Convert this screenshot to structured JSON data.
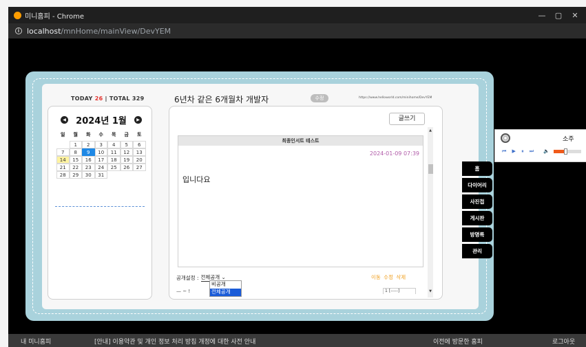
{
  "window": {
    "title": "미니홈피 - Chrome",
    "minimize": "—",
    "maximize": "▢",
    "close": "✕"
  },
  "address": {
    "host": "localhost",
    "path": "/mnHome/mainView/DevYEM"
  },
  "visitors": {
    "today_label": "TODAY",
    "today_count": "26",
    "separator": "|",
    "total_label": "TOTAL",
    "total_count": "329"
  },
  "calendar": {
    "prev": "◀",
    "next": "▶",
    "title": "2024년 1월",
    "weekdays": [
      "일",
      "월",
      "화",
      "수",
      "목",
      "금",
      "토"
    ],
    "weeks": [
      [
        "",
        "1",
        "2",
        "3",
        "4",
        "5",
        "6"
      ],
      [
        "7",
        "8",
        "9",
        "10",
        "11",
        "12",
        "13"
      ],
      [
        "14",
        "15",
        "16",
        "17",
        "18",
        "19",
        "20"
      ],
      [
        "21",
        "22",
        "23",
        "24",
        "25",
        "26",
        "27"
      ],
      [
        "28",
        "29",
        "30",
        "31",
        "",
        "",
        ""
      ]
    ],
    "selected_day": "9",
    "highlight_day": "14"
  },
  "header": {
    "title": "6년차 같은 6개월차 개발자",
    "edit_label": "수정",
    "home_url": "https://www.helloworld.com/minihome/DevYEM"
  },
  "board": {
    "write_label": "글쓰기",
    "post_title": "최종인서트 테스트",
    "post_date": "2024-01-09 07:39",
    "post_body": "입니다요",
    "privacy_label": "공개설정 :",
    "privacy_value": "전체공개 ⌄",
    "privacy_options": [
      "비공개",
      "전체공개"
    ],
    "actions": "이동 수정 삭제",
    "cut_text": "— ~ !",
    "cut_box": "1 [-----]",
    "scroll_up": "▲",
    "scroll_down": "▼"
  },
  "tabs": [
    "홈",
    "다이어리",
    "사진첩",
    "게시판",
    "방명록",
    "관리"
  ],
  "player": {
    "song": "소주",
    "controls": "⏮ ▶ ⏸ ⏭",
    "volume_icon": "🔈",
    "volume_level": 0.45
  },
  "footer": {
    "my_home": "내 미니홈피",
    "notice": "[안내] 이용약관 및 개인 정보 처리 방침 개정에 대한 사전 안내",
    "visited": "이전에 방문한 홈피",
    "logout": "로그아웃"
  },
  "colors": {
    "frame": "#a9d2dc",
    "selected_day": "#1e88e5",
    "highlight_day": "#fff3a0",
    "date_text": "#b05aa8",
    "action_text": "#f0a020"
  }
}
